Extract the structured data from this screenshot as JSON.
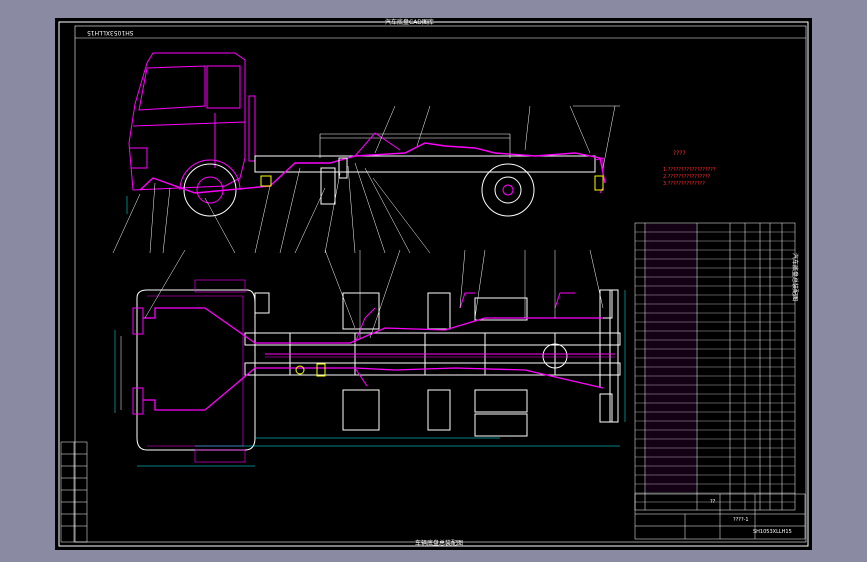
{
  "drawing": {
    "header_text": "汽车底盘CAD图库",
    "footer_text": "车辆底盘总装配图",
    "stamp_text": "SH1053XLLH15",
    "side_title": "汽车底盘总装配图"
  },
  "notes": {
    "title": "????",
    "lines": [
      "1.??????????????????",
      "2.????????????????",
      "3.??????????????"
    ]
  },
  "title_block": {
    "unknown_cell": "??",
    "drawing_ref": "????-1",
    "code": "SH1053XLLH15",
    "model": "SH1053XLLH15"
  },
  "colors": {
    "sheet": "#000000",
    "outer_bg": "#8a8aa3",
    "cab": "#ff00ff",
    "frame_lines": "#ffffff",
    "notes": "#ff2a2a",
    "cyan": "#00ffff",
    "blue": "#4040ff"
  }
}
